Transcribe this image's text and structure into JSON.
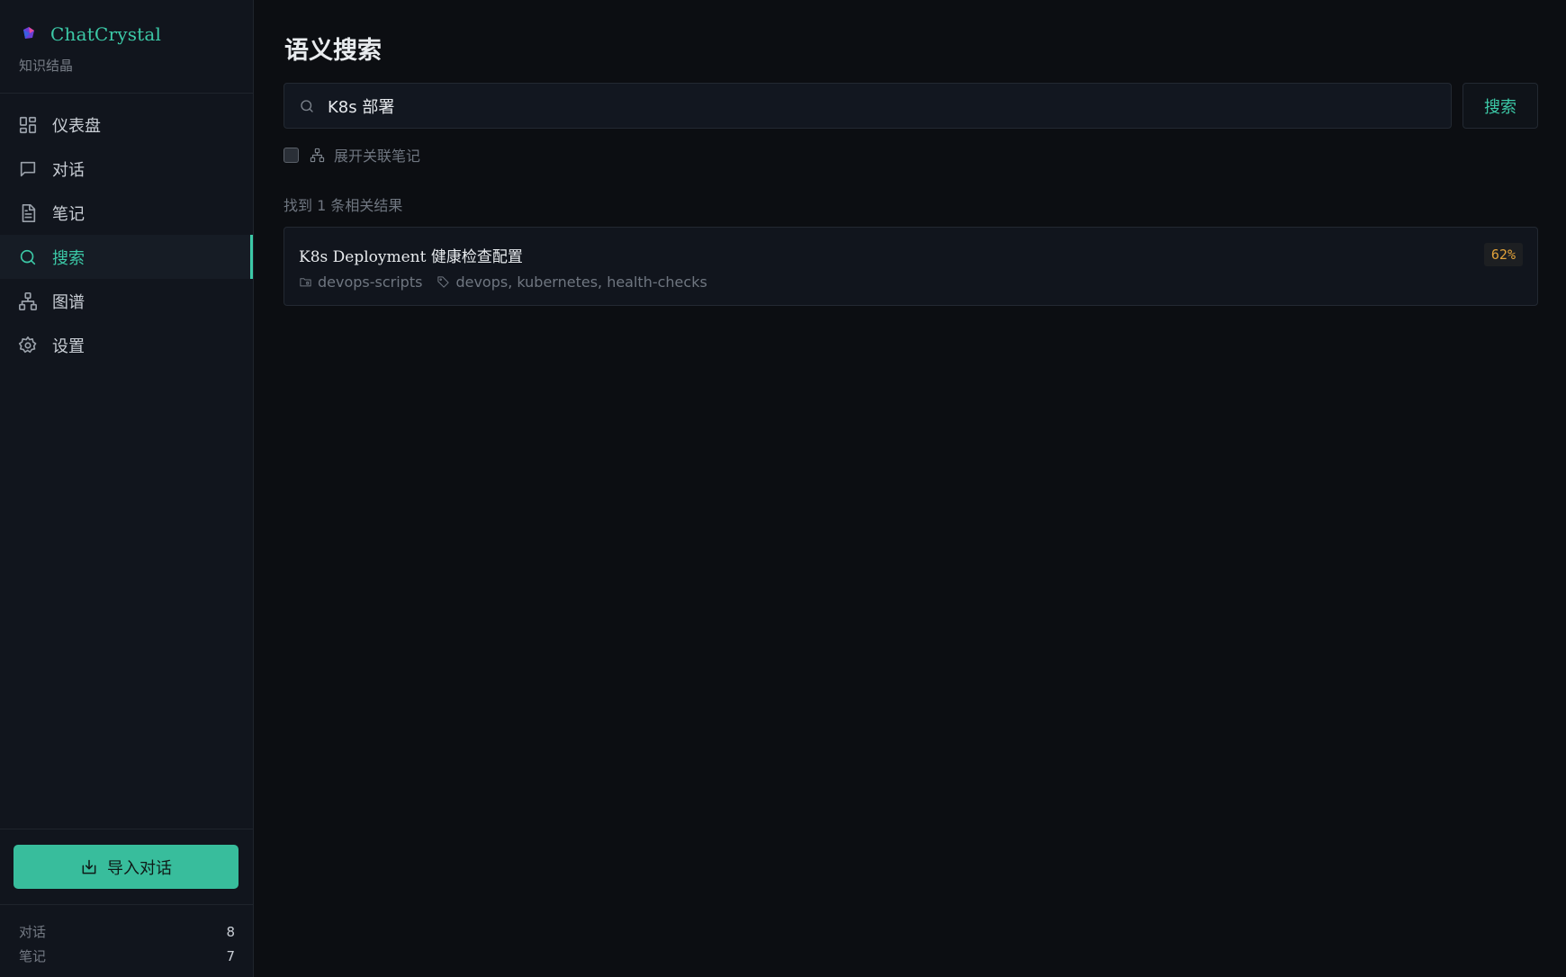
{
  "app": {
    "name": "ChatCrystal",
    "subtitle": "知识结晶",
    "accent_color": "#3cc9a7"
  },
  "sidebar": {
    "items": [
      {
        "label": "仪表盘",
        "icon": "dashboard-icon"
      },
      {
        "label": "对话",
        "icon": "chat-bubble-icon"
      },
      {
        "label": "笔记",
        "icon": "document-icon"
      },
      {
        "label": "搜索",
        "icon": "search-icon",
        "active": true
      },
      {
        "label": "图谱",
        "icon": "graph-icon"
      },
      {
        "label": "设置",
        "icon": "gear-icon"
      }
    ],
    "import_button": "导入对话",
    "stats": [
      {
        "label": "对话",
        "value": "8"
      },
      {
        "label": "笔记",
        "value": "7"
      }
    ]
  },
  "main": {
    "title": "语义搜索",
    "search": {
      "value": "K8s 部署",
      "button": "搜索"
    },
    "expand_label": "展开关联笔记",
    "expand_checked": false,
    "result_count": "找到 1 条相关结果",
    "results": [
      {
        "title": "K8s Deployment 健康检查配置",
        "folder": "devops-scripts",
        "tags": "devops, kubernetes, health-checks",
        "score": "62%"
      }
    ]
  }
}
